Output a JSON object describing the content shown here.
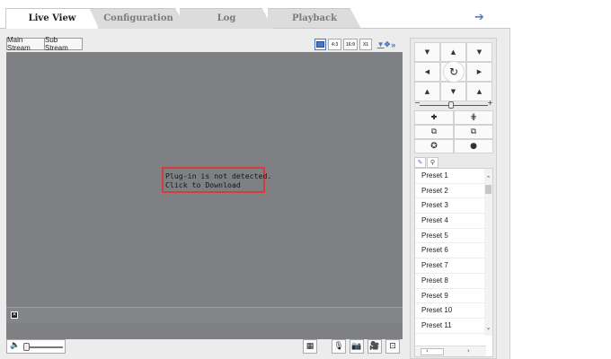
{
  "tabs": {
    "live_view": "Live View",
    "configuration": "Configuration",
    "log": "Log",
    "playback": "Playback"
  },
  "header": {
    "logout_icon": "arrow-right-icon"
  },
  "stream": {
    "main": "Main Stream",
    "sub": "Sub Stream"
  },
  "ratio_buttons": [
    "4:3",
    "16:9",
    "X1"
  ],
  "video": {
    "message_line1": "Plug-in is not detected.",
    "message_line2": "Click to Download"
  },
  "ptz": {
    "presets": [
      "Preset 1",
      "Preset 2",
      "Preset 3",
      "Preset 4",
      "Preset 5",
      "Preset 6",
      "Preset 7",
      "Preset 8",
      "Preset 9",
      "Preset 10",
      "Preset 11"
    ]
  },
  "colors": {
    "video_bg": "#7f8083",
    "alert_border": "#d43d3d",
    "accent": "#4a76c4"
  }
}
